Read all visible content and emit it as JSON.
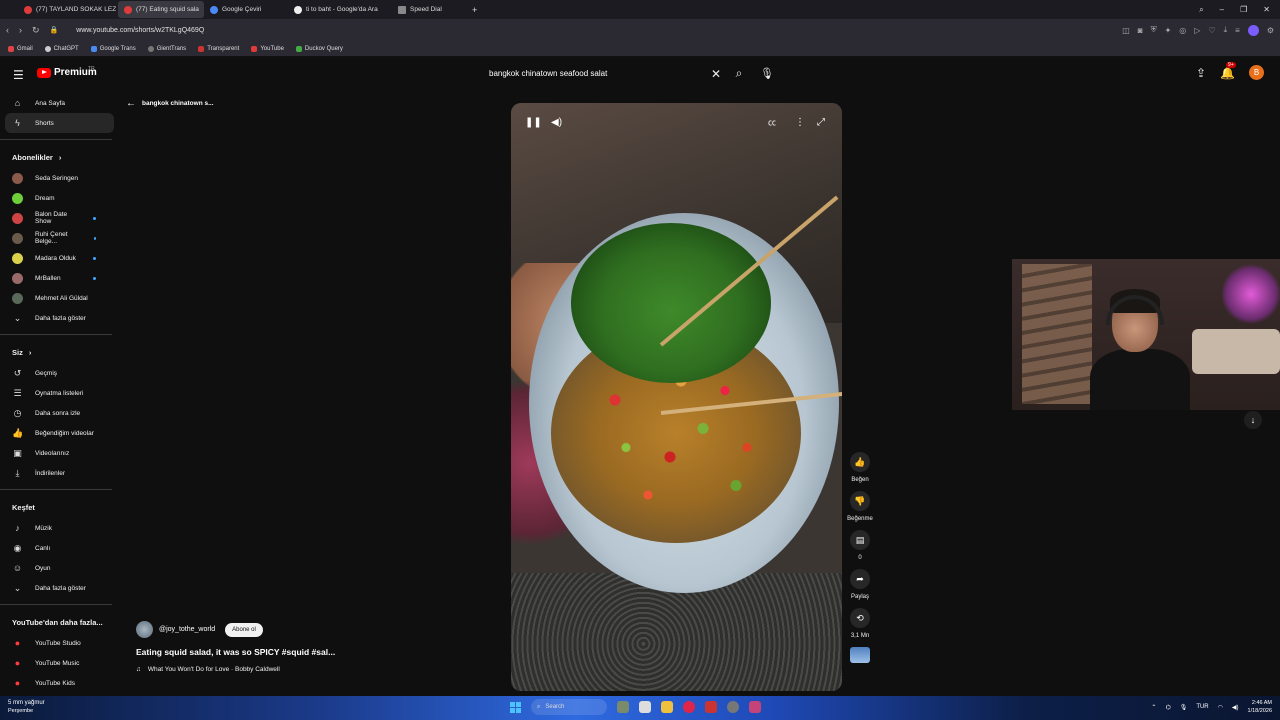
{
  "browser": {
    "tabs": [
      {
        "label": "(77) TAYLAND SOKAK LEZ",
        "active": false
      },
      {
        "label": "(77) Eating squid sala",
        "active": true
      },
      {
        "label": "Google Çeviri",
        "active": false
      },
      {
        "label": "ti to baht - Google'da Ara",
        "active": false
      },
      {
        "label": "Speed Dial",
        "active": false
      }
    ],
    "new_tab": "+",
    "url": "www.youtube.com/shorts/w2TKLgQ469Q",
    "bookmarks": [
      "Gmail",
      "ChatGPT",
      "Google Trans",
      "GientTrans",
      "Transparent",
      "YouTube",
      "Duckov Query"
    ]
  },
  "header": {
    "logo_text": "Premium",
    "logo_region": "TR",
    "search_value": "bangkok chinatown seafood salat",
    "notification_count": "9+",
    "avatar_letter": "B"
  },
  "sidebar": {
    "main": [
      {
        "label": "Ana Sayfa",
        "icon": "home-icon",
        "glyph": "⌂"
      },
      {
        "label": "Shorts",
        "icon": "shorts-icon",
        "glyph": "ϟ"
      }
    ],
    "subs_title": "Abonelikler",
    "subs": [
      {
        "label": "Seda Seringen",
        "color": "#8a5a4a",
        "new": false
      },
      {
        "label": "Dream",
        "color": "#6fcf3a",
        "new": false
      },
      {
        "label": "Balon Date Show",
        "color": "#c44",
        "new": true
      },
      {
        "label": "Ruhi Çenet Belge...",
        "color": "#6a5a4a",
        "new": true
      },
      {
        "label": "Madara Olduk",
        "color": "#d9d14a",
        "new": true
      },
      {
        "label": "MrBallen",
        "color": "#9a6a6a",
        "new": true
      },
      {
        "label": "Mehmet Ali Güldal",
        "color": "#5a6a5a",
        "new": false
      }
    ],
    "subs_more": "Daha fazla göster",
    "you_title": "Siz",
    "you": [
      {
        "label": "Geçmiş",
        "icon": "history-icon",
        "glyph": "↺"
      },
      {
        "label": "Oynatma listeleri",
        "icon": "playlist-icon",
        "glyph": "☰"
      },
      {
        "label": "Daha sonra izle",
        "icon": "clock-icon",
        "glyph": "◷"
      },
      {
        "label": "Beğendiğim videolar",
        "icon": "like-icon",
        "glyph": "👍"
      },
      {
        "label": "Videolarınız",
        "icon": "video-icon",
        "glyph": "▣"
      },
      {
        "label": "İndirilenler",
        "icon": "download-icon",
        "glyph": "⤓"
      }
    ],
    "explore_title": "Keşfet",
    "explore": [
      {
        "label": "Müzik",
        "icon": "music-icon",
        "glyph": "♪"
      },
      {
        "label": "Canlı",
        "icon": "live-icon",
        "glyph": "◉"
      },
      {
        "label": "Oyun",
        "icon": "gaming-icon",
        "glyph": "☺"
      },
      {
        "label": "Daha fazla göster",
        "icon": "chevron-down-icon",
        "glyph": "⌄"
      }
    ],
    "more_title": "YouTube'dan daha fazla...",
    "more": [
      {
        "label": "YouTube Studio",
        "icon": "yt-studio-icon"
      },
      {
        "label": "YouTube Music",
        "icon": "yt-music-icon"
      },
      {
        "label": "YouTube Kids",
        "icon": "yt-kids-icon"
      }
    ]
  },
  "short": {
    "back_label": "bangkok chinatown s...",
    "channel": "@joy_tothe_world",
    "subscribe_label": "Abone ol",
    "title": "Eating squid salad, it was so SPICY #squid #sal...",
    "music": "What You Won't Do for Love · Bobby Caldwell",
    "actions": {
      "like": "Beğen",
      "dislike": "Beğenme",
      "comments": "0",
      "share": "Paylaş",
      "remix": "3,1 Mn"
    }
  },
  "taskbar": {
    "weather_temp": "5 mm yağmur",
    "weather_day": "Perşembe",
    "search_label": "Search",
    "lang": "TUR",
    "time": "2:46 AM",
    "date": "1/18/2026"
  }
}
